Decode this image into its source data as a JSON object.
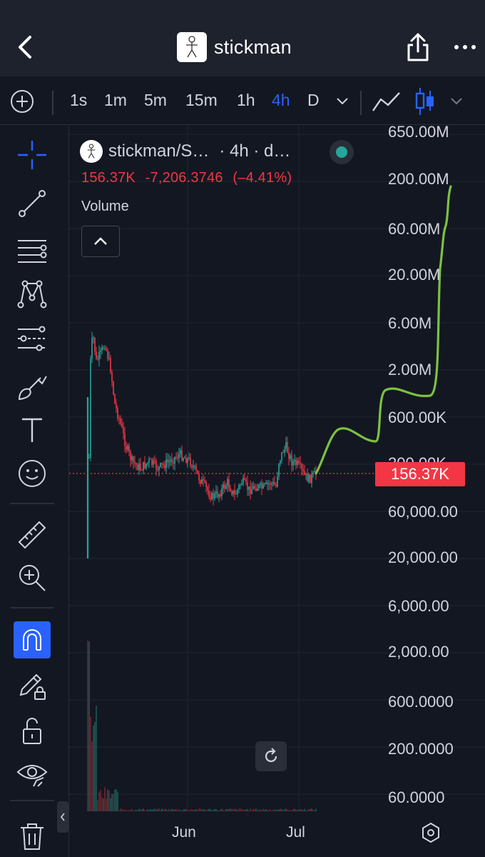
{
  "header": {
    "title": "stickman"
  },
  "timeframes": [
    {
      "label": "1s",
      "active": false
    },
    {
      "label": "1m",
      "active": false
    },
    {
      "label": "5m",
      "active": false
    },
    {
      "label": "15m",
      "active": false
    },
    {
      "label": "1h",
      "active": false
    },
    {
      "label": "4h",
      "active": true
    },
    {
      "label": "D",
      "active": false
    }
  ],
  "legend": {
    "symbol": "stickman/S…",
    "timeframe": "· 4h · d…",
    "status_color": "#26a69a",
    "last": "156.37K",
    "change": "-7,206.3746",
    "change_pct": "(–4.41%)",
    "volume_label": "Volume"
  },
  "price_tag": "156.37K",
  "price_axis": [
    "650.00M",
    "200.00M",
    "60.00M",
    "20.00M",
    "6.00M",
    "2.00M",
    "600.00K",
    "200.00K",
    "60,000.00",
    "20,000.00",
    "6,000.00",
    "2,000.00",
    "600.0000",
    "200.0000",
    "60.0000"
  ],
  "time_axis": [
    "Jun",
    "Jul"
  ],
  "colors": {
    "accent": "#2962ff",
    "up": "#26a69a",
    "down": "#f23645",
    "drawing": "#7cc142",
    "background": "#131722"
  },
  "icons": {
    "left_toolbar": [
      "crosshair-icon",
      "trend-line-icon",
      "fib-retracement-icon",
      "pattern-icon",
      "prediction-icon",
      "brush-icon",
      "text-icon",
      "emoji-icon",
      "ruler-icon",
      "zoom-in-icon",
      "magnet-icon",
      "lock-drawing-icon",
      "unlock-icon",
      "eye-icon",
      "trash-icon"
    ]
  }
}
